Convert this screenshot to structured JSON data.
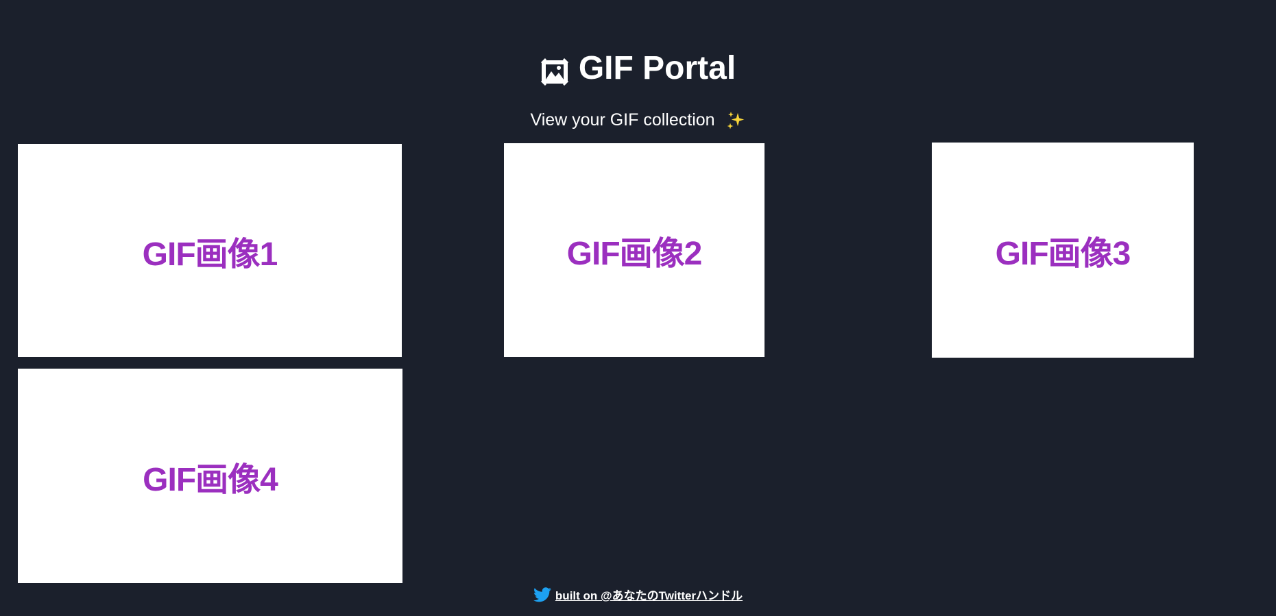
{
  "header": {
    "icon": "framed-picture-icon",
    "title": "GIF Portal",
    "subtitle": "View your GIF collection",
    "subtitle_icon": "sparkles-icon"
  },
  "gallery": {
    "items": [
      {
        "label": "GIF画像1"
      },
      {
        "label": "GIF画像2"
      },
      {
        "label": "GIF画像3"
      },
      {
        "label": "GIF画像4"
      }
    ]
  },
  "footer": {
    "icon": "twitter-icon",
    "link_text": "built on @あなたのTwitterハンドル"
  },
  "colors": {
    "background": "#1b202c",
    "gif_label": "#9b2fbf",
    "twitter_blue": "#1da1f2"
  }
}
